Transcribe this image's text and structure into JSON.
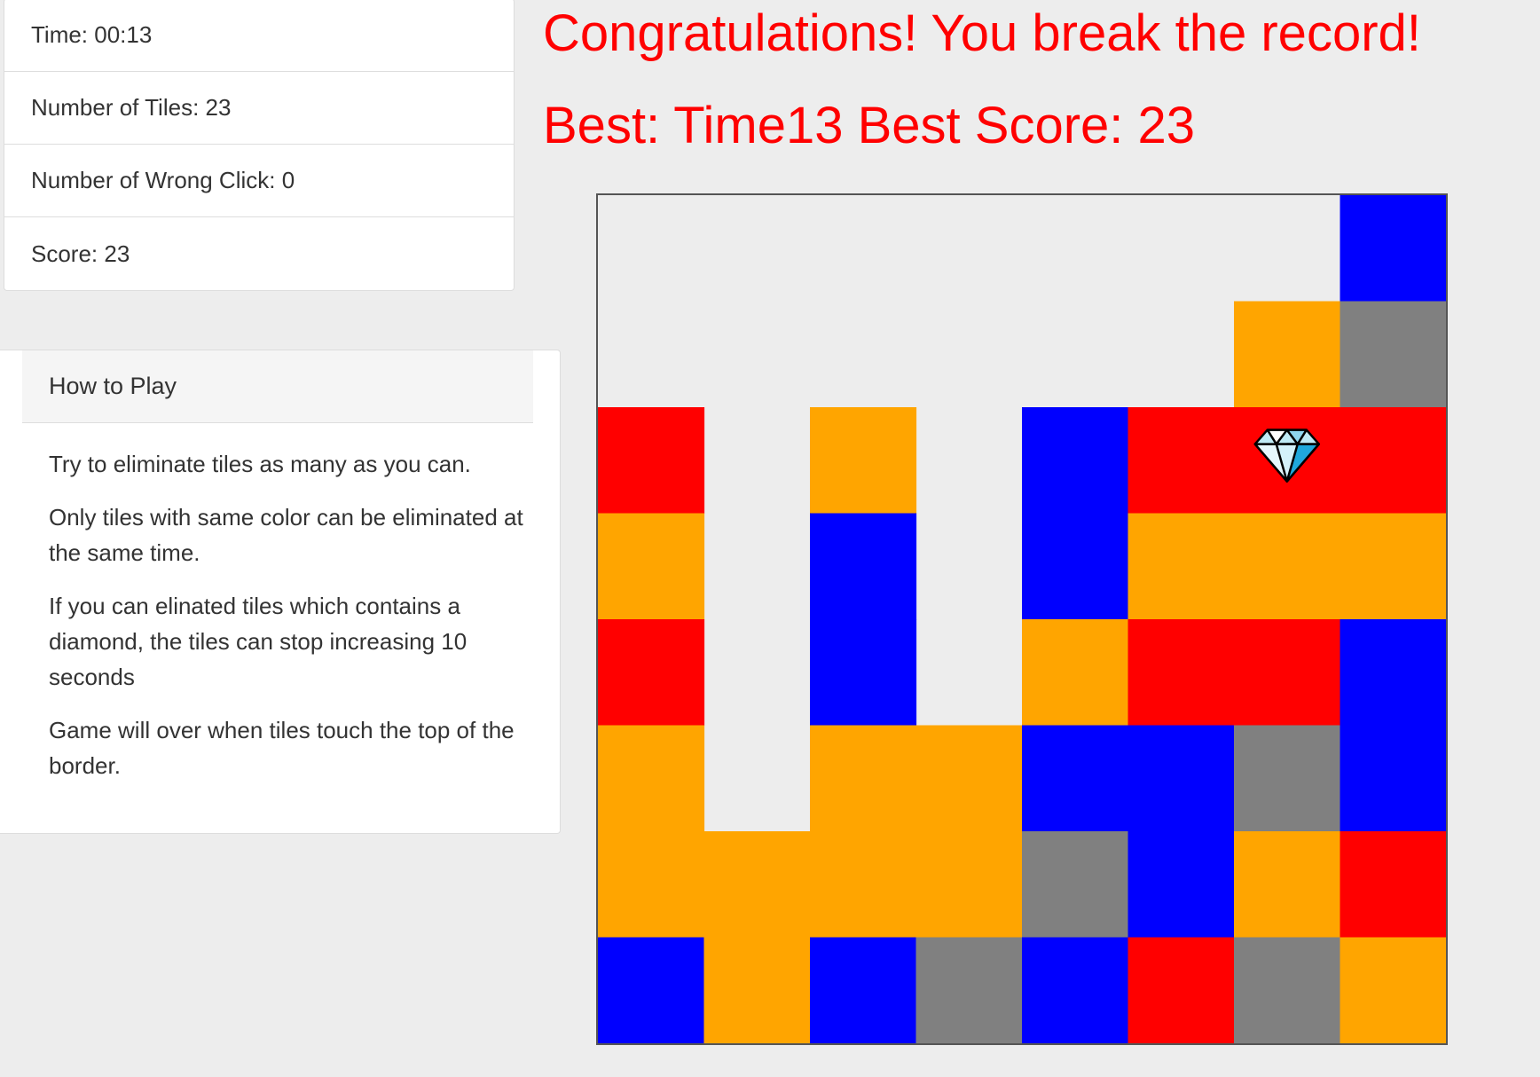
{
  "stats": {
    "time": "Time: 00:13",
    "tiles": "Number of Tiles: 23",
    "wrong_clicks": "Number of Wrong Click: 0",
    "score": "Score: 23"
  },
  "help": {
    "heading": "How to Play",
    "paragraphs": [
      "Try to eliminate tiles as many as you can.",
      "Only tiles with same color can be eliminated at the same time.",
      "If you can elinated tiles which contains a diamond, the tiles can stop increasing 10 seconds",
      "Game will over when tiles touch the top of the border."
    ]
  },
  "messages": {
    "congrats": "Congratulations! You break the record!",
    "best": "Best: Time13 Best Score: 23"
  },
  "colors": {
    "R": "#ff0000",
    "O": "#ffa500",
    "B": "#0000ff",
    "G": "#808080",
    "background": "#ededed",
    "message": "#ff0000"
  },
  "board": {
    "columns": 8,
    "rows": 8,
    "grid": [
      "0000000B",
      "000000OG",
      "R0O0BRRR",
      "O0B0BOOO",
      "R0B0ORRB",
      "O0OOBBGB",
      "OOOOGBOR",
      "BOBGBRGO"
    ],
    "diamond": {
      "row": 2,
      "col": 6,
      "icon": "diamond-icon"
    }
  }
}
